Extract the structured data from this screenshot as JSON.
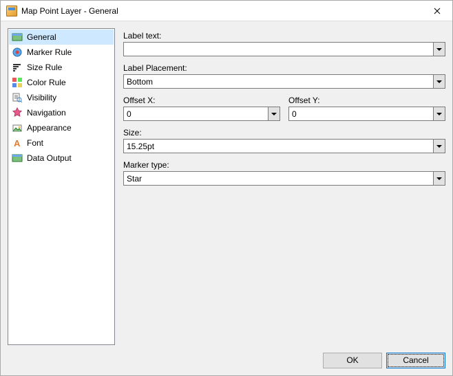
{
  "window": {
    "title": "Map Point Layer - General"
  },
  "sidebar": {
    "items": [
      {
        "label": "General",
        "icon": "layer-icon",
        "selected": true
      },
      {
        "label": "Marker Rule",
        "icon": "marker-rule-icon",
        "selected": false
      },
      {
        "label": "Size Rule",
        "icon": "size-rule-icon",
        "selected": false
      },
      {
        "label": "Color Rule",
        "icon": "color-rule-icon",
        "selected": false
      },
      {
        "label": "Visibility",
        "icon": "visibility-icon",
        "selected": false
      },
      {
        "label": "Navigation",
        "icon": "navigation-icon",
        "selected": false
      },
      {
        "label": "Appearance",
        "icon": "appearance-icon",
        "selected": false
      },
      {
        "label": "Font",
        "icon": "font-icon",
        "selected": false
      },
      {
        "label": "Data Output",
        "icon": "data-output-icon",
        "selected": false
      }
    ]
  },
  "form": {
    "labelText": {
      "label": "Label text:",
      "value": ""
    },
    "labelPlacement": {
      "label": "Label Placement:",
      "value": "Bottom"
    },
    "offsetX": {
      "label": "Offset X:",
      "value": "0"
    },
    "offsetY": {
      "label": "Offset Y:",
      "value": "0"
    },
    "size": {
      "label": "Size:",
      "value": "15.25pt"
    },
    "markerType": {
      "label": "Marker type:",
      "value": "Star"
    }
  },
  "footer": {
    "ok": "OK",
    "cancel": "Cancel"
  }
}
